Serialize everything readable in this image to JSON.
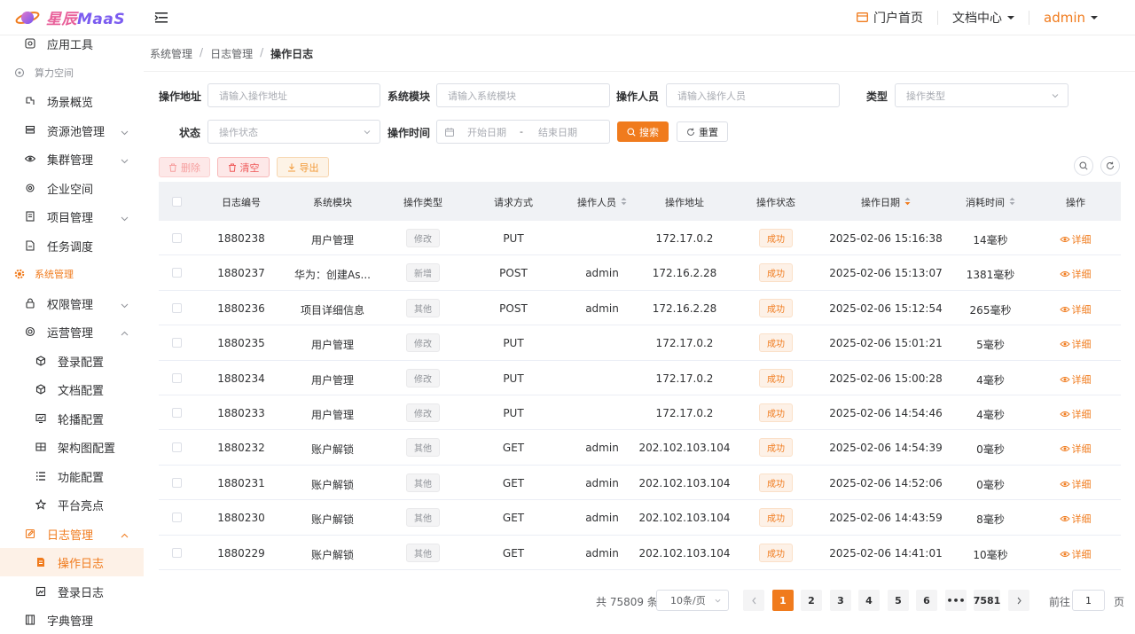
{
  "app": {
    "logo_cn": "星辰",
    "logo_en": "MaaS"
  },
  "header": {
    "portal": "门户首页",
    "docs": "文档中心",
    "user": "admin"
  },
  "sidebar": {
    "items": [
      {
        "label": "应用工具",
        "type": "item",
        "icon": "app-icon"
      },
      {
        "label": "算力空间",
        "type": "group",
        "icon": "compute-icon"
      },
      {
        "label": "场景概览",
        "type": "item",
        "icon": "scene-icon"
      },
      {
        "label": "资源池管理",
        "type": "item",
        "icon": "database-icon",
        "chevron": "down"
      },
      {
        "label": "集群管理",
        "type": "item",
        "icon": "eye-icon",
        "chevron": "down"
      },
      {
        "label": "企业空间",
        "type": "item",
        "icon": "settings-icon"
      },
      {
        "label": "项目管理",
        "type": "item",
        "icon": "document-icon",
        "chevron": "down"
      },
      {
        "label": "任务调度",
        "type": "item",
        "icon": "file-icon"
      },
      {
        "label": "系统管理",
        "type": "group-active",
        "icon": "gear-icon"
      },
      {
        "label": "权限管理",
        "type": "item",
        "icon": "lock-icon",
        "chevron": "down"
      },
      {
        "label": "运营管理",
        "type": "item",
        "icon": "circle-icon",
        "chevron": "up"
      },
      {
        "label": "登录配置",
        "type": "sub",
        "icon": "cube-icon"
      },
      {
        "label": "文档配置",
        "type": "sub",
        "icon": "cube-icon"
      },
      {
        "label": "轮播配置",
        "type": "sub",
        "icon": "monitor-icon"
      },
      {
        "label": "架构图配置",
        "type": "sub",
        "icon": "grid-icon"
      },
      {
        "label": "功能配置",
        "type": "sub",
        "icon": "list-icon"
      },
      {
        "label": "平台亮点",
        "type": "sub",
        "icon": "star-icon"
      },
      {
        "label": "日志管理",
        "type": "item-active",
        "icon": "edit-icon",
        "chevron": "up"
      },
      {
        "label": "操作日志",
        "type": "sub-selected",
        "icon": "log-icon"
      },
      {
        "label": "登录日志",
        "type": "sub",
        "icon": "image-icon"
      },
      {
        "label": "字典管理",
        "type": "item",
        "icon": "book-icon"
      }
    ]
  },
  "breadcrumb": [
    "系统管理",
    "日志管理",
    "操作日志"
  ],
  "filters": {
    "address_label": "操作地址",
    "address_placeholder": "请输入操作地址",
    "module_label": "系统模块",
    "module_placeholder": "请输入系统模块",
    "operator_label": "操作人员",
    "operator_placeholder": "请输入操作人员",
    "type_label": "类型",
    "type_placeholder": "操作类型",
    "status_label": "状态",
    "status_placeholder": "操作状态",
    "time_label": "操作时间",
    "start_placeholder": "开始日期",
    "range_sep": "-",
    "end_placeholder": "结束日期",
    "search_btn": "搜索",
    "reset_btn": "重置"
  },
  "toolbar": {
    "delete": "删除",
    "clear": "清空",
    "export": "导出"
  },
  "table": {
    "headers": [
      "日志编号",
      "系统模块",
      "操作类型",
      "请求方式",
      "操作人员",
      "操作地址",
      "操作状态",
      "操作日期",
      "消耗时间",
      "操作"
    ],
    "detail_label": "详细",
    "rows": [
      {
        "id": "1880238",
        "module": "用户管理",
        "type": "修改",
        "method": "PUT",
        "operator": "",
        "ip": "172.17.0.2",
        "status": "成功",
        "date": "2025-02-06 15:16:38",
        "cost": "14毫秒"
      },
      {
        "id": "1880237",
        "module": "华为：创建As...",
        "type": "新增",
        "method": "POST",
        "operator": "admin",
        "ip": "172.16.2.28",
        "status": "成功",
        "date": "2025-02-06 15:13:07",
        "cost": "1381毫秒"
      },
      {
        "id": "1880236",
        "module": "项目详细信息",
        "type": "其他",
        "method": "POST",
        "operator": "admin",
        "ip": "172.16.2.28",
        "status": "成功",
        "date": "2025-02-06 15:12:54",
        "cost": "265毫秒"
      },
      {
        "id": "1880235",
        "module": "用户管理",
        "type": "修改",
        "method": "PUT",
        "operator": "",
        "ip": "172.17.0.2",
        "status": "成功",
        "date": "2025-02-06 15:01:21",
        "cost": "5毫秒"
      },
      {
        "id": "1880234",
        "module": "用户管理",
        "type": "修改",
        "method": "PUT",
        "operator": "",
        "ip": "172.17.0.2",
        "status": "成功",
        "date": "2025-02-06 15:00:28",
        "cost": "4毫秒"
      },
      {
        "id": "1880233",
        "module": "用户管理",
        "type": "修改",
        "method": "PUT",
        "operator": "",
        "ip": "172.17.0.2",
        "status": "成功",
        "date": "2025-02-06 14:54:46",
        "cost": "4毫秒"
      },
      {
        "id": "1880232",
        "module": "账户解锁",
        "type": "其他",
        "method": "GET",
        "operator": "admin",
        "ip": "202.102.103.104",
        "status": "成功",
        "date": "2025-02-06 14:54:39",
        "cost": "0毫秒"
      },
      {
        "id": "1880231",
        "module": "账户解锁",
        "type": "其他",
        "method": "GET",
        "operator": "admin",
        "ip": "202.102.103.104",
        "status": "成功",
        "date": "2025-02-06 14:52:06",
        "cost": "0毫秒"
      },
      {
        "id": "1880230",
        "module": "账户解锁",
        "type": "其他",
        "method": "GET",
        "operator": "admin",
        "ip": "202.102.103.104",
        "status": "成功",
        "date": "2025-02-06 14:43:59",
        "cost": "8毫秒"
      },
      {
        "id": "1880229",
        "module": "账户解锁",
        "type": "其他",
        "method": "GET",
        "operator": "admin",
        "ip": "202.102.103.104",
        "status": "成功",
        "date": "2025-02-06 14:41:01",
        "cost": "10毫秒"
      }
    ]
  },
  "pagination": {
    "total": "共 75809 条",
    "page_size": "10条/页",
    "pages": [
      "1",
      "2",
      "3",
      "4",
      "5",
      "6",
      "•••",
      "7581"
    ],
    "current": "1",
    "goto_label": "前往",
    "goto_value": "1",
    "page_suffix": "页"
  },
  "colors": {
    "accent": "#f07b1d",
    "success_tag_bg": "#fdf1e7",
    "header_bg": "#f0f2f5"
  }
}
